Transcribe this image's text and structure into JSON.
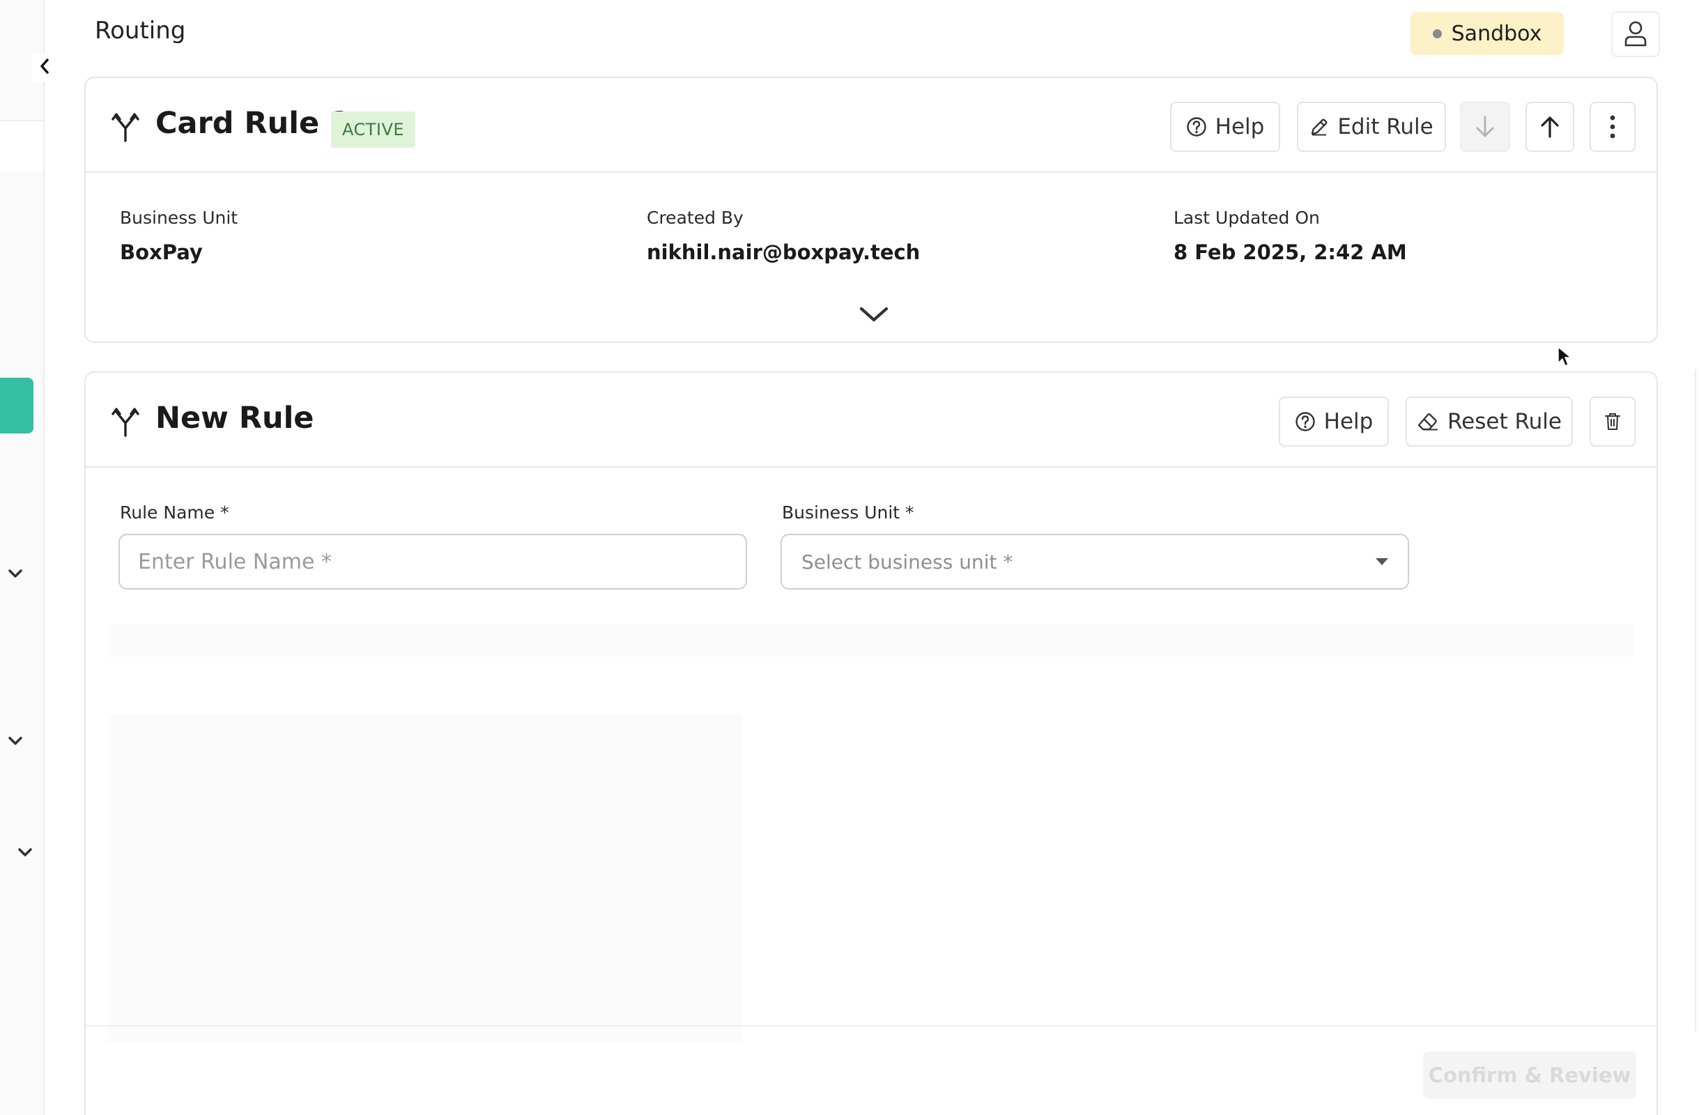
{
  "header": {
    "title": "Routing",
    "environment": "Sandbox"
  },
  "active_rule": {
    "title": "Card Rule 2",
    "status": "ACTIVE",
    "buttons": {
      "help": "Help",
      "edit": "Edit Rule"
    },
    "meta": [
      {
        "label": "Business Unit",
        "value": "BoxPay"
      },
      {
        "label": "Created By",
        "value": "nikhil.nair@boxpay.tech"
      },
      {
        "label": "Last Updated On",
        "value": "8 Feb 2025, 2:42 AM"
      }
    ]
  },
  "new_rule": {
    "title": "New Rule",
    "buttons": {
      "help": "Help",
      "reset": "Reset Rule",
      "confirm": "Confirm & Review"
    },
    "form": {
      "rule_name_label": "Rule Name *",
      "rule_name_placeholder": "Enter Rule Name *",
      "business_unit_label": "Business Unit *",
      "business_unit_placeholder": "Select business unit *"
    }
  },
  "icons": {
    "collapse": "chevron-left-icon",
    "rule": "routing-split-icon",
    "help": "question-circle-icon",
    "edit": "pencil-icon",
    "reset": "eraser-icon",
    "delete": "trash-icon",
    "more": "more-vertical-icon",
    "move_down": "arrow-down-icon",
    "move_up": "arrow-up-icon",
    "expand": "chevron-down-icon",
    "user": "user-icon"
  },
  "colors": {
    "sidebar_accent": "#35bfa4",
    "environment_badge_bg": "#fdf2c7",
    "status_badge_bg": "#dff3d9",
    "status_badge_text": "#3e7a43"
  }
}
